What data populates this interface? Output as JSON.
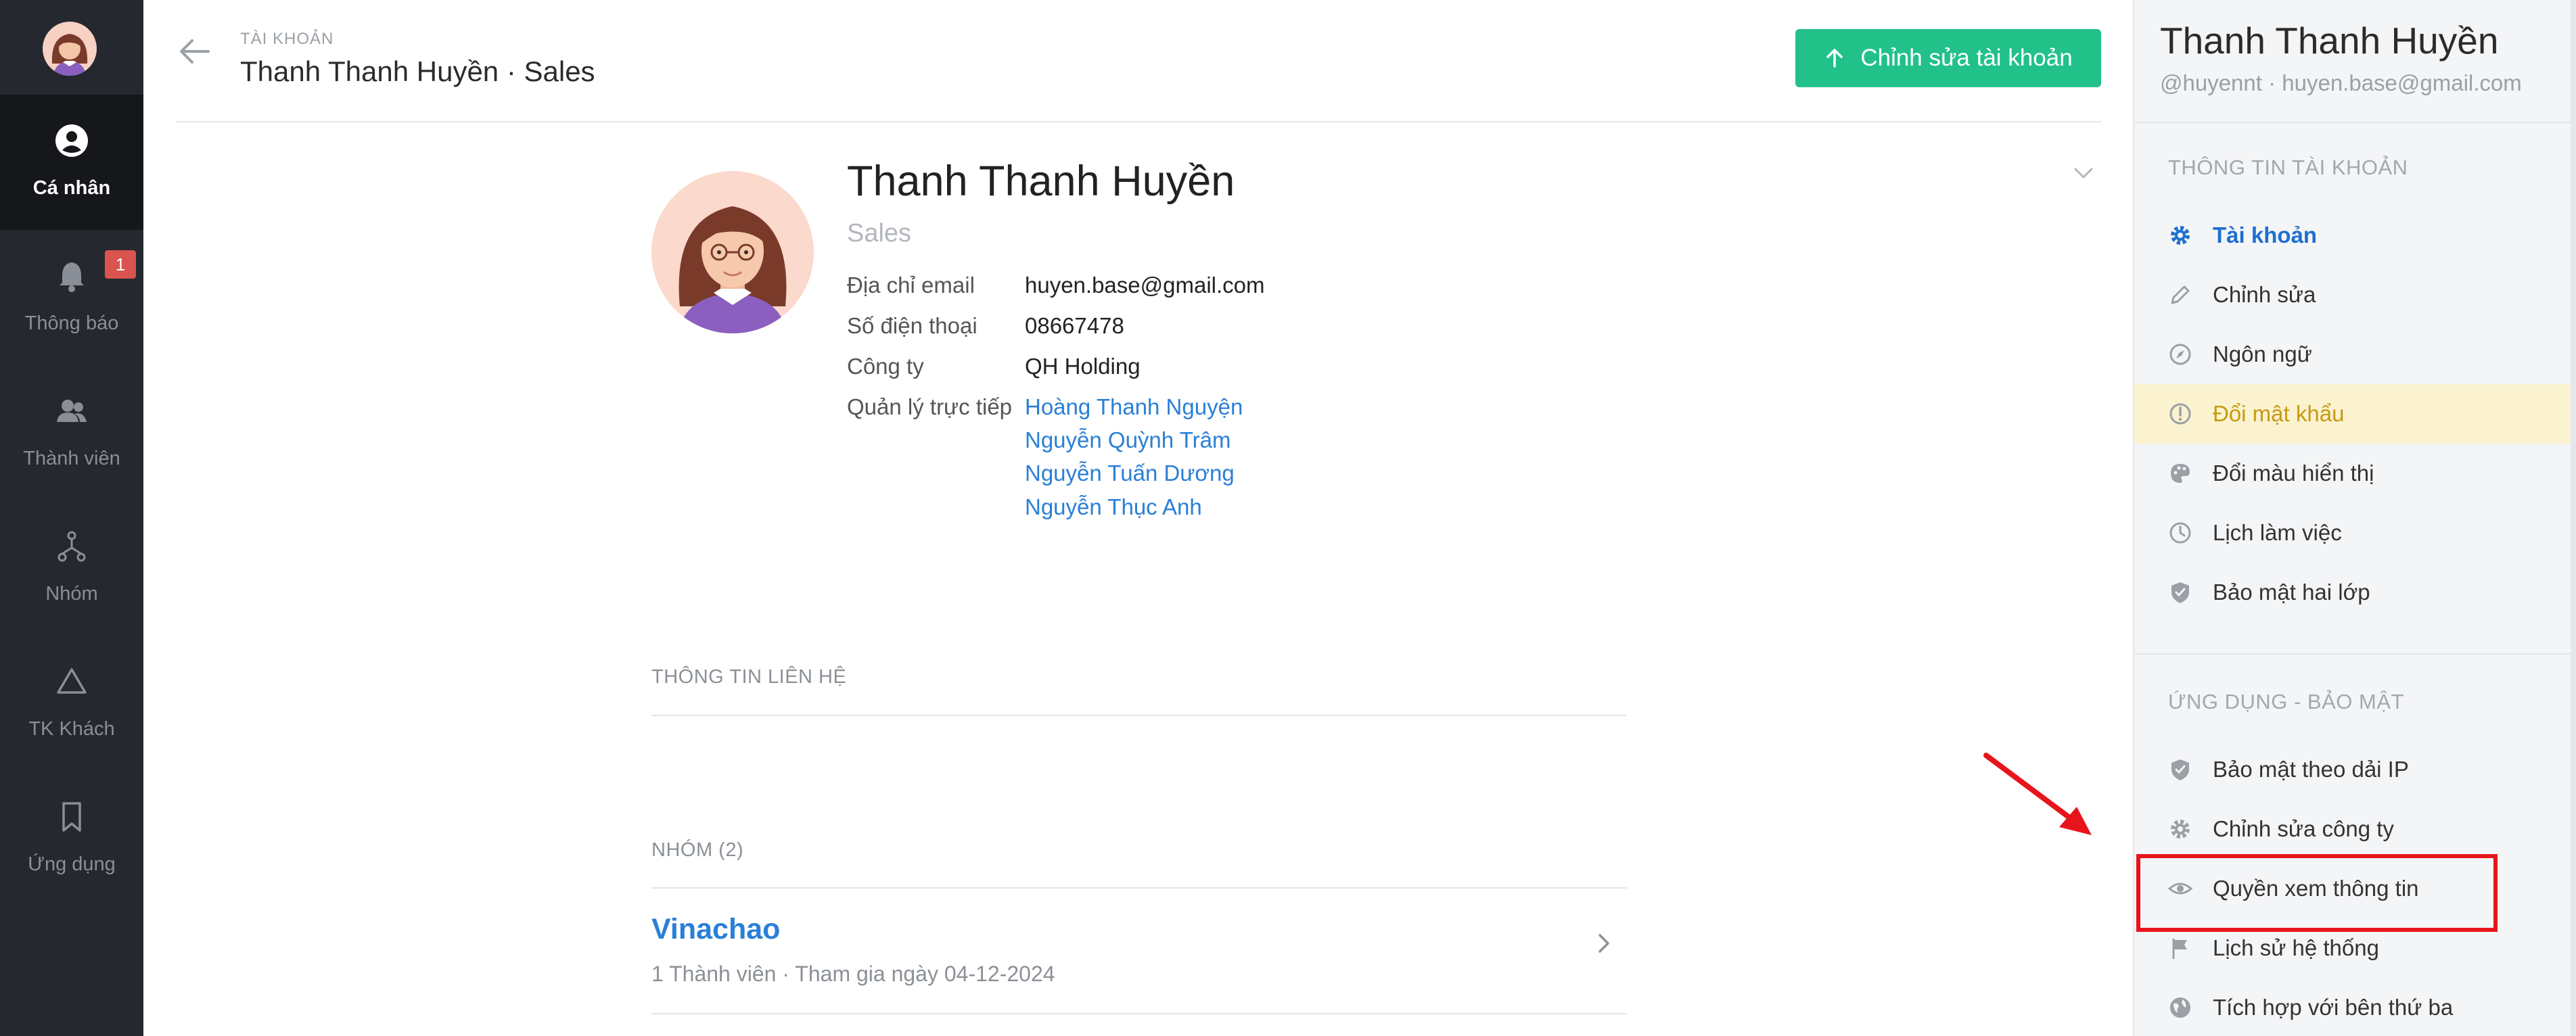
{
  "left_nav": {
    "items": [
      {
        "label": "Cá nhân",
        "icon": "user-circle-icon",
        "active": true
      },
      {
        "label": "Thông báo",
        "icon": "bell-icon",
        "badge": "1"
      },
      {
        "label": "Thành viên",
        "icon": "users-icon"
      },
      {
        "label": "Nhóm",
        "icon": "group-tree-icon"
      },
      {
        "label": "TK Khách",
        "icon": "triangle-icon"
      },
      {
        "label": "Ứng dụng",
        "icon": "bookmark-icon"
      }
    ]
  },
  "header": {
    "breadcrumb_small": "TÀI KHOẢN",
    "title": "Thanh Thanh Huyền · Sales",
    "edit_button": "Chỉnh sửa tài khoản"
  },
  "profile": {
    "name": "Thanh Thanh Huyền",
    "role": "Sales",
    "rows": [
      {
        "label": "Địa chỉ email",
        "value": "huyen.base@gmail.com"
      },
      {
        "label": "Số điện thoại",
        "value": "08667478"
      },
      {
        "label": "Công ty",
        "value": "QH Holding"
      }
    ],
    "managers_label": "Quản lý trực tiếp",
    "managers": [
      "Hoàng Thanh Nguyện",
      "Nguyễn Quỳnh Trâm",
      "Nguyễn Tuấn Dương",
      "Nguyễn Thục Anh"
    ]
  },
  "contact_section": {
    "title": "THÔNG TIN LIÊN HỆ"
  },
  "groups_section": {
    "title": "NHÓM (2)",
    "groups": [
      {
        "name": "Vinachao",
        "meta": "1 Thành viên · Tham gia ngày 04-12-2024"
      }
    ]
  },
  "right_panel": {
    "name": "Thanh Thanh Huyền",
    "subtitle": "@huyennt  ·  huyen.base@gmail.com",
    "account_section": "THÔNG TIN TÀI KHOẢN",
    "account_items": [
      {
        "label": "Tài khoản",
        "icon": "gear-icon",
        "active": true
      },
      {
        "label": "Chỉnh sửa",
        "icon": "pencil-icon"
      },
      {
        "label": "Ngôn ngữ",
        "icon": "compass-icon"
      },
      {
        "label": "Đổi mật khẩu",
        "icon": "alert-circle-icon",
        "highlighted": true
      },
      {
        "label": "Đổi màu hiển thị",
        "icon": "palette-icon"
      },
      {
        "label": "Lịch làm việc",
        "icon": "clock-icon"
      },
      {
        "label": "Bảo mật hai lớp",
        "icon": "shield-icon"
      }
    ],
    "security_section": "ỨNG DỤNG - BẢO MẬT",
    "security_items": [
      {
        "label": "Bảo mật theo dải IP",
        "icon": "shield-icon"
      },
      {
        "label": "Chỉnh sửa công ty",
        "icon": "gear-icon"
      },
      {
        "label": "Quyền xem thông tin",
        "icon": "eye-icon"
      },
      {
        "label": "Lịch sử hệ thống",
        "icon": "flag-icon"
      },
      {
        "label": "Tích hợp với bên thứ ba",
        "icon": "globe-icon"
      }
    ]
  },
  "colors": {
    "nav_bg": "#25282e",
    "accent_green": "#22c189",
    "link_blue": "#2a7fd6",
    "highlight_red": "#e8141b",
    "warning_yellow": "#c79a14"
  }
}
